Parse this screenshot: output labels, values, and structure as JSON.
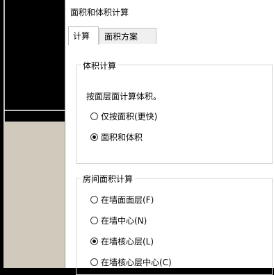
{
  "dialog": {
    "title": "面积和体积计算",
    "tabs": [
      {
        "label": "计算",
        "active": true
      },
      {
        "label": "面积方案",
        "active": false
      }
    ],
    "volume_group": {
      "title": "体积计算",
      "description": "按面层面计算体积。",
      "options": [
        {
          "label": "仅按面积(更快)",
          "checked": false
        },
        {
          "label": "面积和体积",
          "checked": true
        }
      ]
    },
    "room_area_group": {
      "title": "房间面积计算",
      "options": [
        {
          "label": "在墙面面层(F)",
          "checked": false
        },
        {
          "label": "在墙中心(N)",
          "checked": false
        },
        {
          "label": "在墙核心层(L)",
          "checked": true
        },
        {
          "label": "在墙核心层中心(C)",
          "checked": false
        }
      ]
    }
  },
  "colors": {
    "background": "#000000",
    "canvas_fill": "#cfcabb",
    "cad_line": "#ffffff"
  }
}
